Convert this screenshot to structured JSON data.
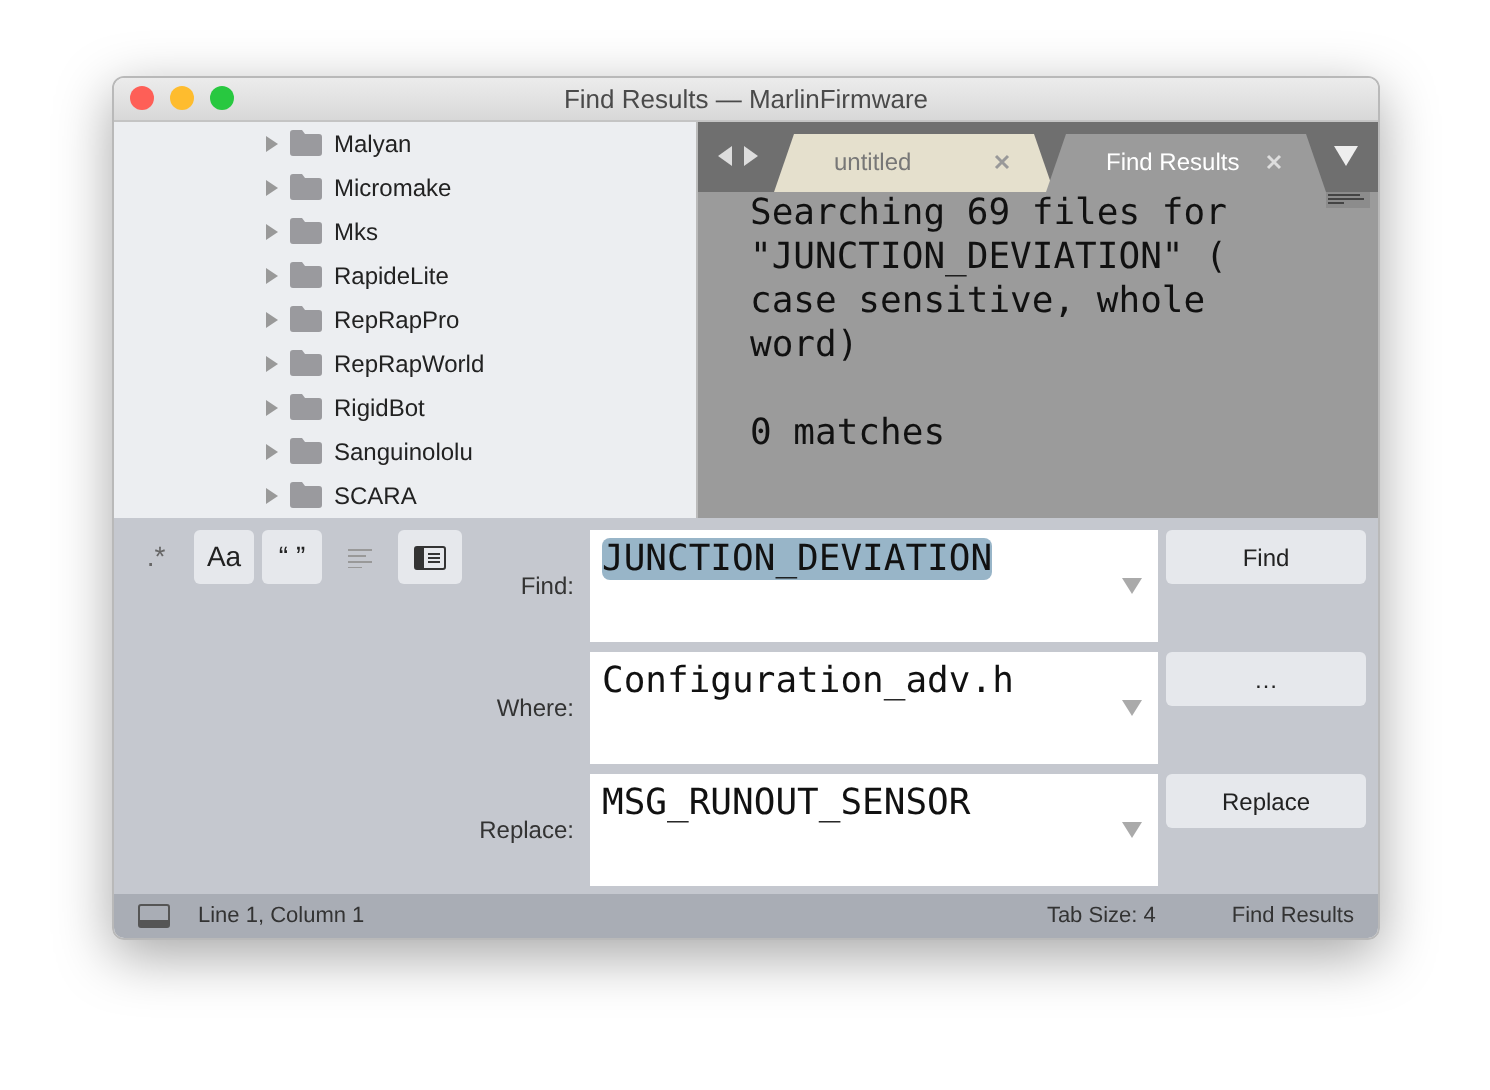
{
  "window": {
    "title": "Find Results — MarlinFirmware"
  },
  "sidebar": {
    "items": [
      {
        "label": "Malyan",
        "expanded": false
      },
      {
        "label": "Micromake",
        "expanded": false
      },
      {
        "label": "Mks",
        "expanded": false
      },
      {
        "label": "RapideLite",
        "expanded": false
      },
      {
        "label": "RepRapPro",
        "expanded": false
      },
      {
        "label": "RepRapWorld",
        "expanded": false
      },
      {
        "label": "RigidBot",
        "expanded": false
      },
      {
        "label": "Sanguinololu",
        "expanded": false
      },
      {
        "label": "SCARA",
        "expanded": false
      }
    ]
  },
  "tabs": [
    {
      "label": "untitled",
      "selected": false
    },
    {
      "label": "Find Results",
      "selected": true
    }
  ],
  "editor": {
    "paragraphs": [
      {
        "lines": [
          "Searching 69 files for",
          "\"JUNCTION_DEVIATION\" (",
          "case sensitive, whole",
          "word)"
        ]
      },
      {
        "lines": [
          "0 matches"
        ]
      }
    ]
  },
  "find_panel": {
    "options": [
      {
        "kind": "text",
        "label": ".*",
        "on": false
      },
      {
        "kind": "text",
        "label": "Aa",
        "on": true
      },
      {
        "kind": "text",
        "label": "“ ”",
        "on": true
      },
      {
        "kind": "lines",
        "on": false
      },
      {
        "kind": "panel",
        "on": true
      }
    ],
    "fields": [
      {
        "label": "Find:",
        "value": "JUNCTION_DEVIATION",
        "highlighted": true,
        "button": "Find"
      },
      {
        "label": "Where:",
        "value": "Configuration_adv.h",
        "highlighted": false,
        "button": "…"
      },
      {
        "label": "Replace:",
        "value": "MSG_RUNOUT_SENSOR",
        "highlighted": false,
        "button": "Replace"
      }
    ]
  },
  "status_bar": {
    "position": "Line 1, Column 1",
    "tab_size": "Tab Size: 4",
    "syntax": "Find Results"
  }
}
